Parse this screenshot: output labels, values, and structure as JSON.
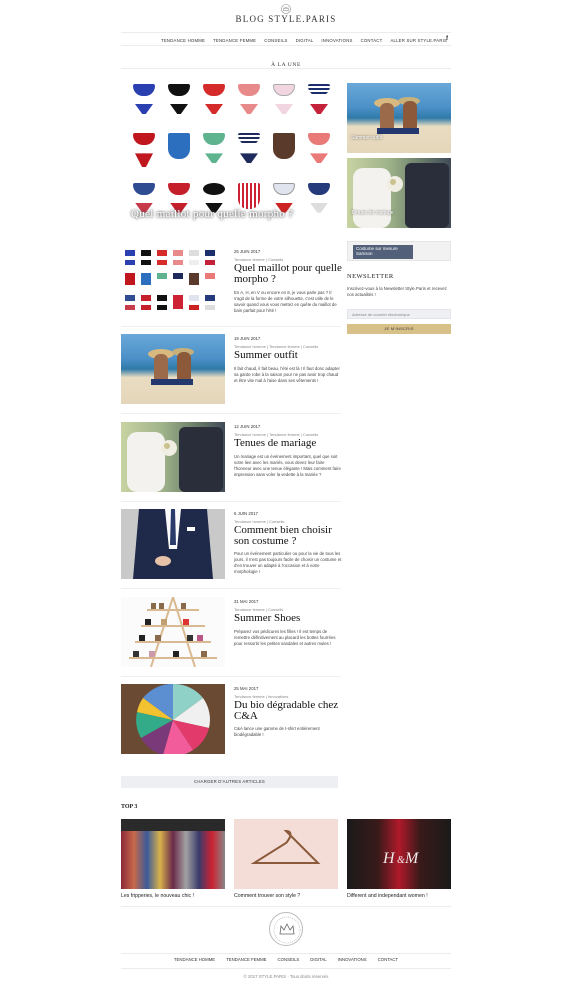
{
  "site": {
    "name": "BLOG STYLE.PARIS"
  },
  "nav": {
    "items": [
      "TENDANCE HOMME",
      "TENDANCE FEMME",
      "CONSEILS",
      "DIGITAL",
      "INNOVATIONS",
      "CONTACT",
      "ALLER SUR STYLE.PARIS"
    ],
    "social": "f"
  },
  "featured": {
    "section_title": "À LA UNE",
    "main_caption": "Quel maillot pour quelle morpho ?",
    "side": [
      {
        "caption": "Summer outfit"
      },
      {
        "caption": "Tenues de mariage"
      }
    ]
  },
  "ad": {
    "label": "Costume sur mesure Samson"
  },
  "newsletter": {
    "title": "NEWSLETTER",
    "text": "Inscrivez-vous à la Newsletter Style.Paris et recevez nos actualités !",
    "placeholder": "Adresse de courrier électronique",
    "button": "JE M'INSCRIS"
  },
  "articles": [
    {
      "date": "25 JUIN 2017",
      "category": "Tendance femme | Conseils",
      "title": "Quel maillot pour quelle morpho ?",
      "excerpt": "En A, H, en V ou encore en 8, je vous parle pas ? Il s'agit de la forme de votre silhouette, c'est utile de le savoir quand vous vous mettez en quête du maillot de bain parfait pour l'été !"
    },
    {
      "date": "19 JUIN 2017",
      "category": "Tendance homme | Tendance femme | Conseils",
      "title": "Summer outfit",
      "excerpt": "Il fait chaud, il fait beau, l'été est là ! Il faut donc adapter sa garde robe à la saison pour ne pas avoir trop chaud et être vite mal à l'aise dans ses vêtements !"
    },
    {
      "date": "12 JUIN 2017",
      "category": "Tendance homme | Tendance femme | Conseils",
      "title": "Tenues de mariage",
      "excerpt": "Un mariage est un événement important, quel que soit votre lien avec les mariés, vous devez leur faire l'honneur avec une tenue élégante ! Mais comment faire impression sans voler la vedette à la mariée ?"
    },
    {
      "date": "6 JUIN 2017",
      "category": "Tendance homme | Conseils",
      "title": "Comment bien choisir son costume ?",
      "excerpt": "Pour un événement particulier ou pour la vie de tous les jours, il n'est pas toujours facile de choisir un costume et d'en trouver un adapté à l'occasion et à votre morphologie !"
    },
    {
      "date": "31 MAI 2017",
      "category": "Tendance femme | Conseils",
      "title": "Summer Shoes",
      "excerpt": "Préparez vos pédicures les filles ! Il est temps de remettre définitivement au placard les bottes fourrées pour ressortir les petites sandales et autres mules !"
    },
    {
      "date": "25 MAI 2017",
      "category": "Tendance femme | Innovations",
      "title": "Du bio dégradable chez C&A",
      "excerpt": "C&A lance une gamme de t-shirt entièrement biodégradable !"
    }
  ],
  "load_more": "CHARGER D'AUTRES ARTICLES",
  "top3": {
    "title": "TOP 3",
    "items": [
      {
        "caption": "Les fripperies, le nouveau chic !"
      },
      {
        "caption": "Comment trouver son style ?"
      },
      {
        "caption": "Different and independant women !"
      }
    ]
  },
  "footer": {
    "nav": [
      "TENDANCE HOMME",
      "TENDANCE FEMME",
      "CONSEILS",
      "DIGITAL",
      "INNOVATIONS",
      "CONTACT"
    ],
    "copyright": "© 2017 STYLE.PARIS · Tous droits réservés"
  },
  "colors": {
    "accent_button": "#d8c188",
    "ad_label_bg": "#52607a",
    "load_more_bg": "#eeeff3"
  }
}
